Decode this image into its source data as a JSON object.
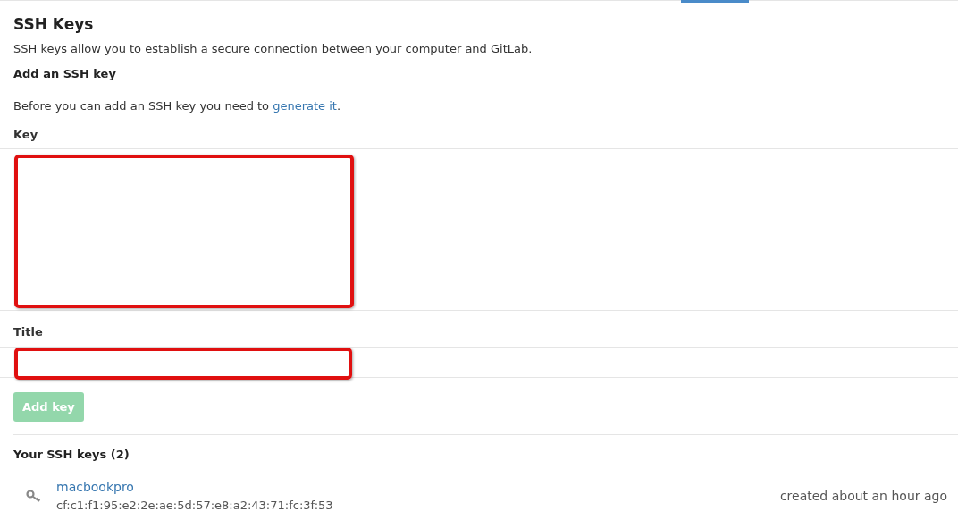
{
  "heading": "SSH Keys",
  "intro": "SSH keys allow you to establish a secure connection between your computer and GitLab.",
  "add_section": {
    "title": "Add an SSH key",
    "text": "Before you can add an SSH key you need to",
    "link": "generate it",
    "after": "."
  },
  "fields": [
    {
      "label": "Key",
      "kind": "textarea",
      "highlighted": true
    },
    {
      "label": "Title",
      "kind": "input",
      "highlighted": true
    }
  ],
  "submit": {
    "label": "Add key",
    "disabled": true
  },
  "keys_section": {
    "title": "Your SSH keys (2)"
  },
  "keys": [
    {
      "title": "macbookpro",
      "fingerprint": "cf:c1:f1:95:e2:2e:ae:5d:57:e8:a2:43:71:fc:3f:53",
      "created": "created about an hour ago"
    }
  ]
}
